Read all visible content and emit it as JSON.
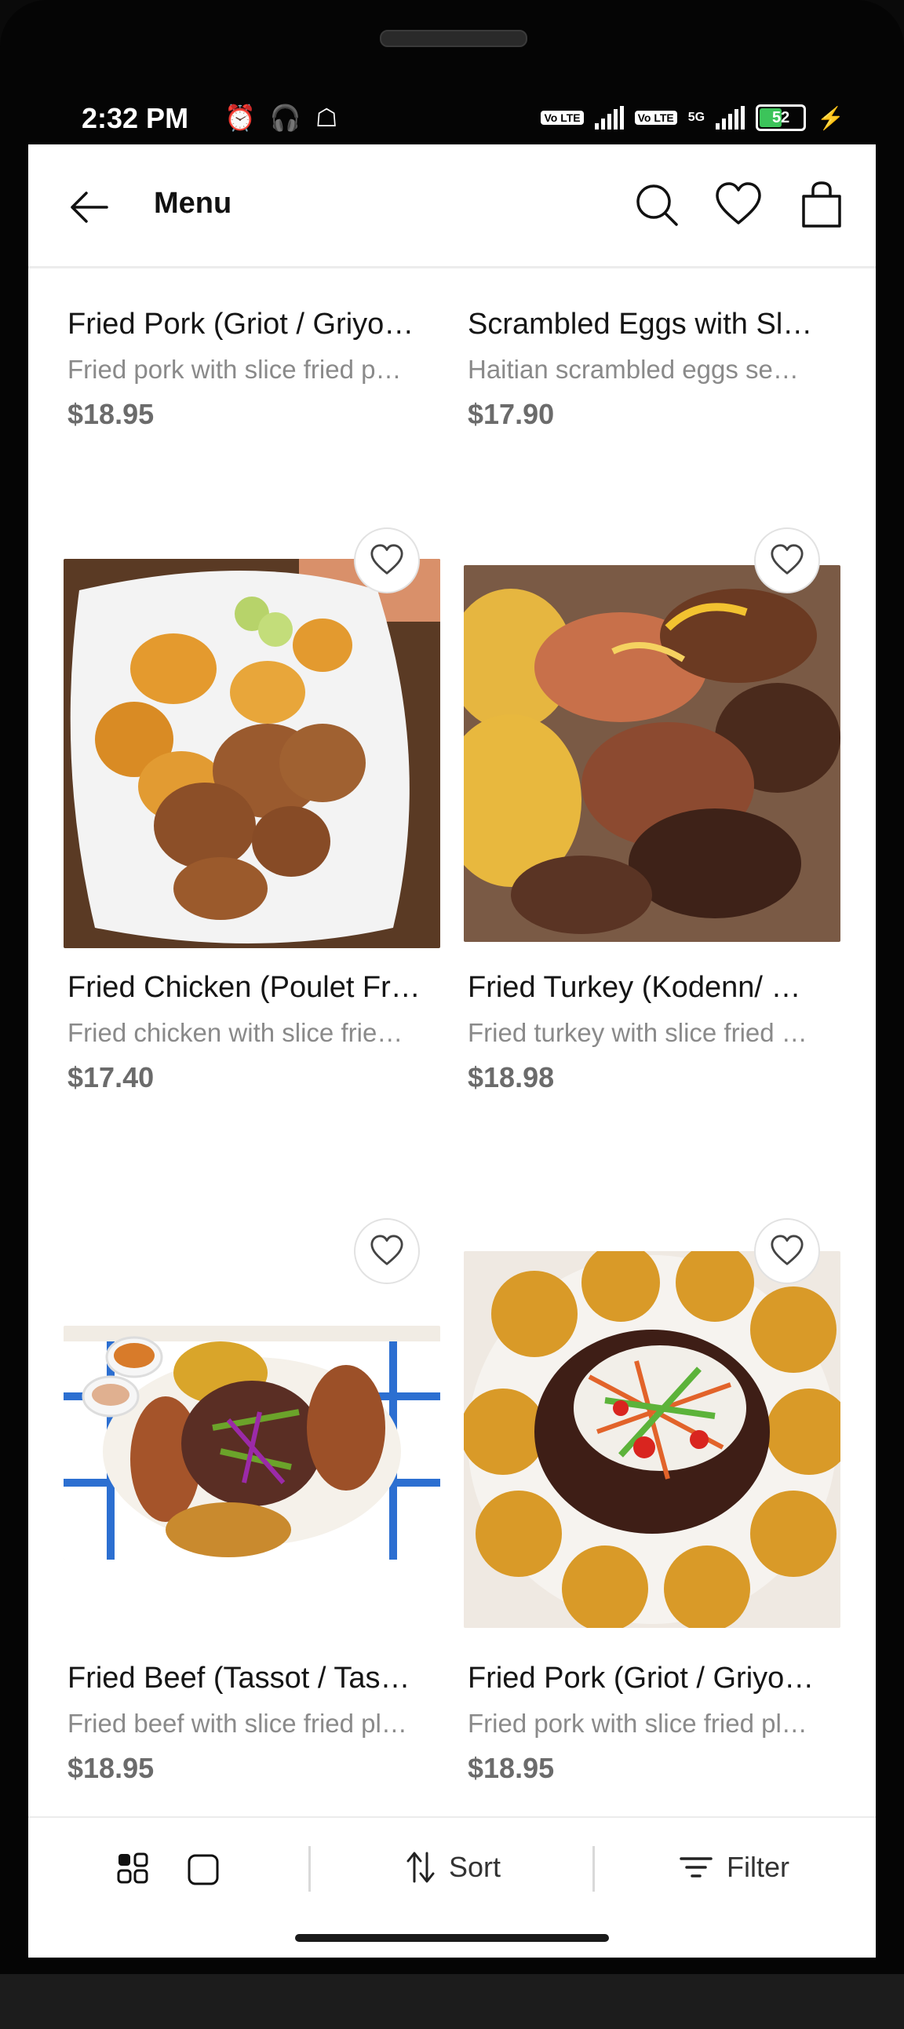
{
  "status_bar": {
    "time": "2:32 PM",
    "battery": "52",
    "network": "5G",
    "volte": "Vo LTE"
  },
  "header": {
    "title": "Menu",
    "back_icon": "arrow-left-icon",
    "search_icon": "search-icon",
    "favorites_icon": "heart-icon",
    "bag_icon": "shopping-bag-icon"
  },
  "items": [
    {
      "title": "Fried Pork (Griot / Griyo…",
      "desc": "Fried pork with slice fried p…",
      "price": "$18.95"
    },
    {
      "title": "Scrambled Eggs with Sl…",
      "desc": "Haitian scrambled eggs se…",
      "price": "$17.90"
    },
    {
      "title": "Fried Chicken (Poulet Fr…",
      "desc": "Fried chicken with slice frie…",
      "price": "$17.40",
      "image_icon": "fried-chicken-plantains-photo"
    },
    {
      "title": "Fried Turkey (Kodenn/ …",
      "desc": "Fried turkey with slice fried …",
      "price": "$18.98",
      "image_icon": "fried-turkey-photo"
    },
    {
      "title": "Fried Beef (Tassot / Tas…",
      "desc": "Fried beef with slice fried pl…",
      "price": "$18.95",
      "image_icon": "fried-beef-platter-photo"
    },
    {
      "title": "Fried Pork (Griot / Griyo…",
      "desc": "Fried pork with slice fried pl…",
      "price": "$18.95",
      "image_icon": "fried-pork-pikliz-photo"
    }
  ],
  "toolbar": {
    "sort_label": "Sort",
    "filter_label": "Filter",
    "grid_view_icon": "grid-view-icon",
    "single_view_icon": "single-view-icon",
    "sort_icon": "sort-icon",
    "filter_icon": "filter-icon"
  },
  "colors": {
    "accent": "#111111",
    "price": "#6b6b6b",
    "desc": "#8a8a8a"
  }
}
